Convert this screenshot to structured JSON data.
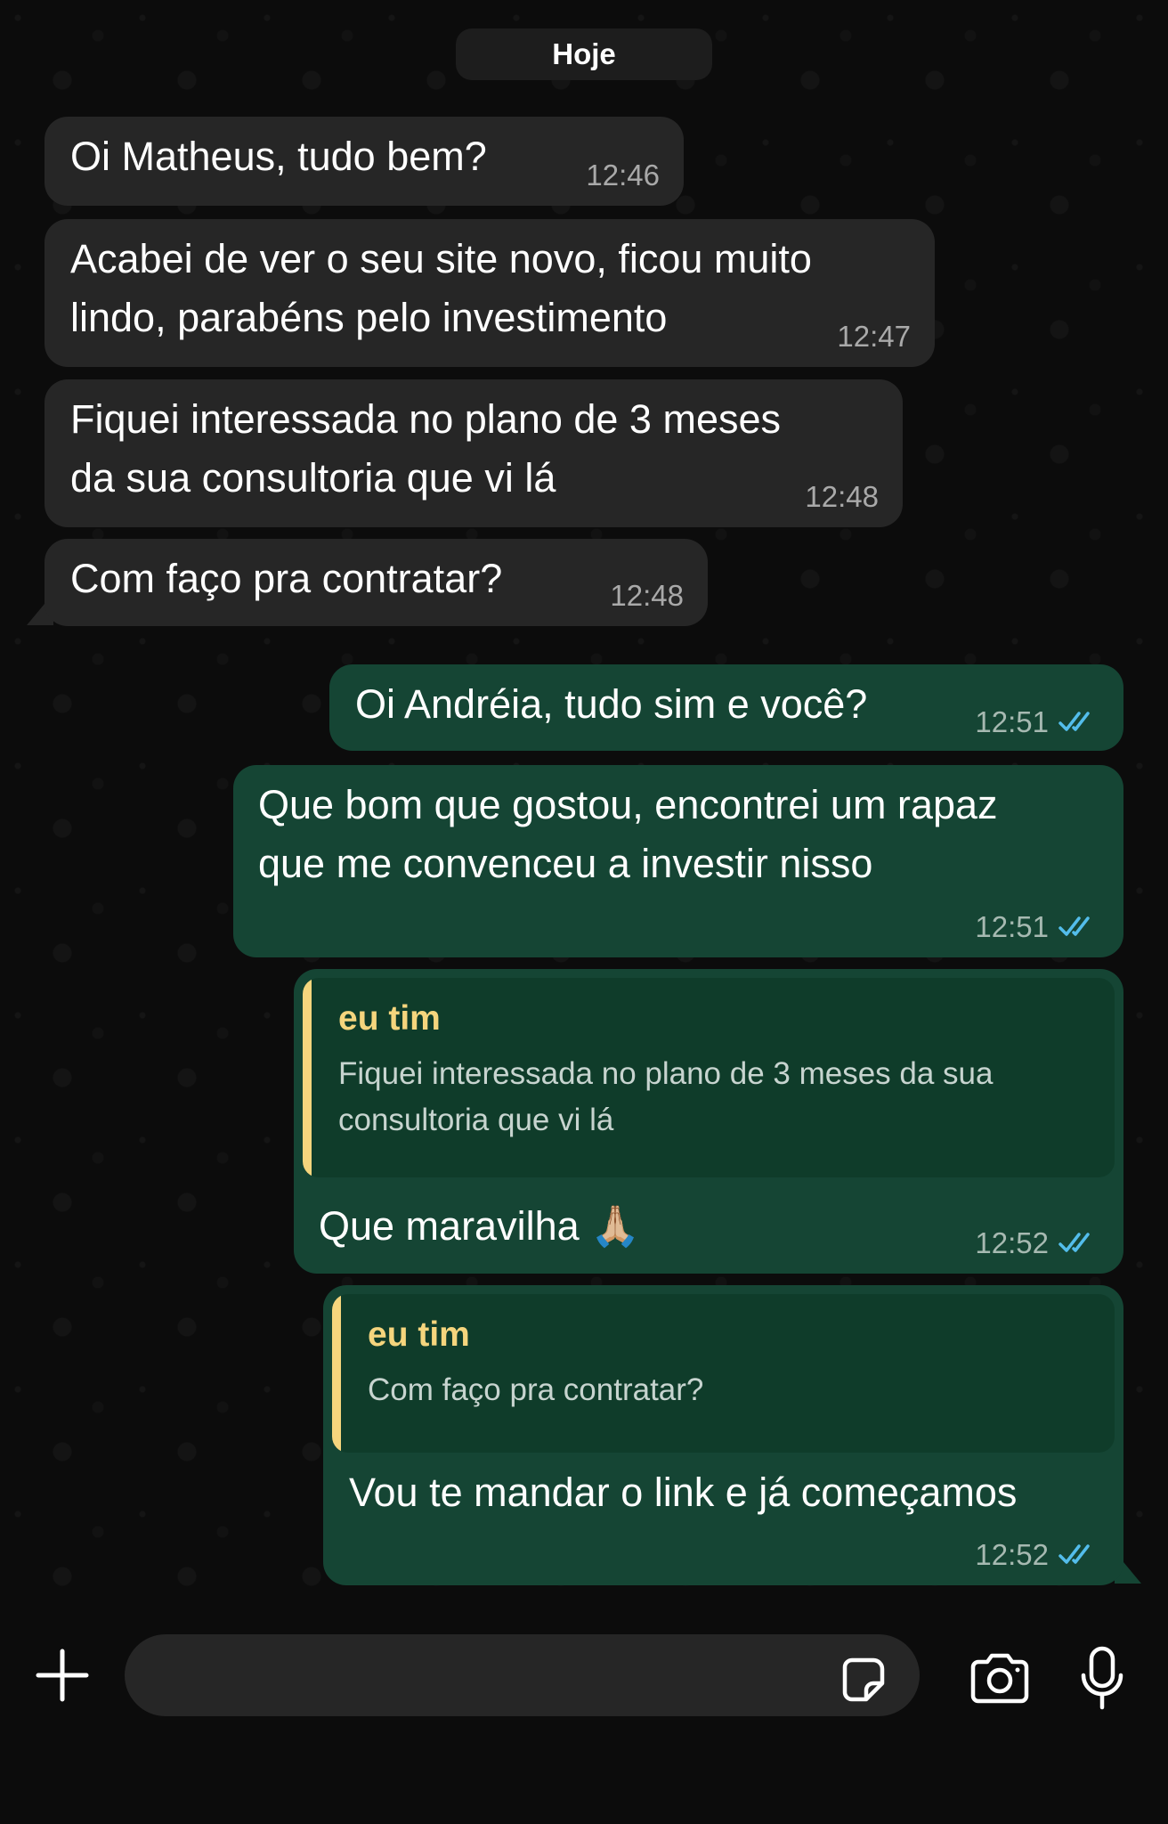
{
  "date_divider": "Hoje",
  "messages": [
    {
      "dir": "in",
      "text_lines": [
        "Oi Matheus, tudo bem?"
      ],
      "time": "12:46"
    },
    {
      "dir": "in",
      "text_lines": [
        "Acabei de ver o seu site novo, ficou muito",
        "lindo, parabéns pelo investimento"
      ],
      "time": "12:47"
    },
    {
      "dir": "in",
      "text_lines": [
        "Fiquei interessada no plano de 3 meses",
        "da sua consultoria que vi lá"
      ],
      "time": "12:48"
    },
    {
      "dir": "in",
      "text_lines": [
        "Com faço pra contratar?"
      ],
      "time": "12:48"
    },
    {
      "dir": "out",
      "text_lines": [
        "Oi Andréia, tudo sim e você?"
      ],
      "time": "12:51",
      "status": "read"
    },
    {
      "dir": "out",
      "text_lines": [
        "Que bom que gostou, encontrei um rapaz",
        "que me convenceu a investir nisso"
      ],
      "time": "12:51",
      "status": "read"
    },
    {
      "dir": "out",
      "reply": {
        "author": "eu tim",
        "text_lines": [
          "Fiquei interessada no plano de 3 meses da sua",
          "consultoria que vi lá"
        ]
      },
      "text_lines": [
        "Que maravilha 🙏🏼"
      ],
      "time": "12:52",
      "status": "read"
    },
    {
      "dir": "out",
      "reply": {
        "author": "eu tim",
        "text_lines": [
          "Com faço pra contratar?"
        ]
      },
      "text_lines": [
        "Vou te mandar o link e já começamos"
      ],
      "time": "12:52",
      "status": "read"
    }
  ],
  "composer": {
    "input_value": "",
    "icons": [
      "plus-icon",
      "sticker-icon",
      "camera-icon",
      "microphone-icon"
    ]
  },
  "colors": {
    "incoming_bubble": "#262626",
    "outgoing_bubble": "#154534",
    "quote_accent": "#f5d57d",
    "read_ticks": "#53bdeb"
  }
}
